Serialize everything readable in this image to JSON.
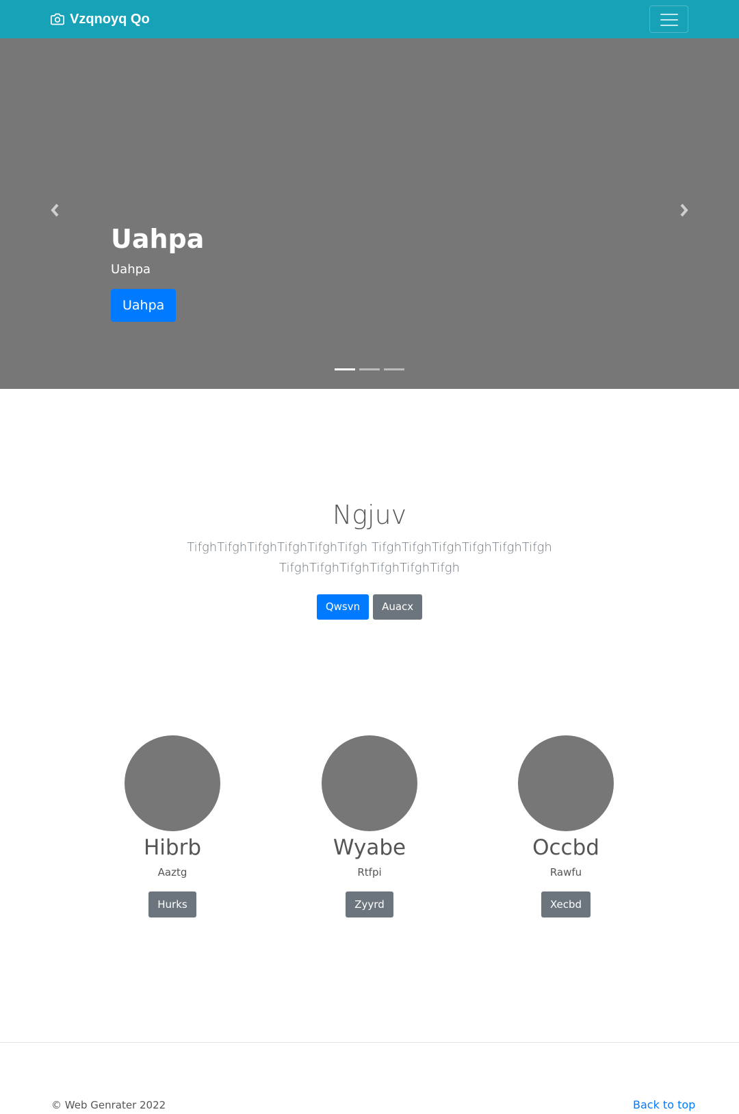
{
  "navbar": {
    "brand": "Vzqnoyq Qo",
    "brand_icon": "camera-icon",
    "toggle_icon": "hamburger-menu-icon",
    "background": "#17a2b8"
  },
  "carousel": {
    "title": "Uahpa",
    "subtitle": "Uahpa",
    "button_label": "Uahpa",
    "prev_icon": "chevron-left-icon",
    "next_icon": "chevron-right-icon",
    "slide_count": 3,
    "active_slide": 1,
    "background": "#777777"
  },
  "intro": {
    "heading": "Ngjuv",
    "lead_line1": "TifghTifghTifghTifghTifghTifgh TifghTifghTifghTifghTifghTifgh",
    "lead_line2": "TifghTifghTifghTifghTifghTifgh",
    "primary_button": "Qwsvn",
    "secondary_button": "Auacx"
  },
  "features": [
    {
      "title": "Hibrb",
      "text": "Aaztg",
      "button": "Hurks"
    },
    {
      "title": "Wyabe",
      "text": "Rtfpi",
      "button": "Zyyrd"
    },
    {
      "title": "Occbd",
      "text": "Rawfu",
      "button": "Xecbd"
    }
  ],
  "footer": {
    "copyright": "© Web Genrater 2022",
    "back_to_top": "Back to top"
  },
  "colors": {
    "primary": "#007bff",
    "secondary": "#6c757d",
    "placeholder_gray": "#777777"
  }
}
